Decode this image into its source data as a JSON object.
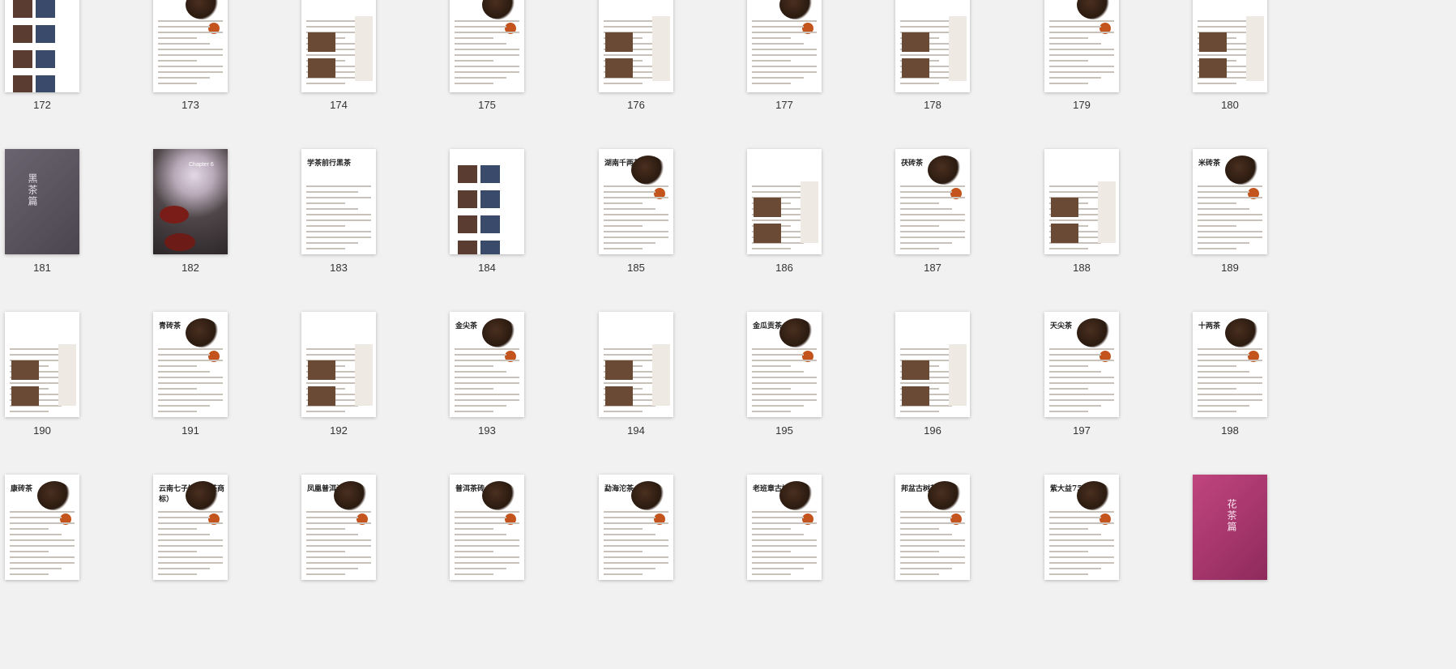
{
  "pages": [
    {
      "label": "172",
      "kind": "photos"
    },
    {
      "label": "173",
      "kind": "tea"
    },
    {
      "label": "174",
      "kind": "text-photos"
    },
    {
      "label": "175",
      "kind": "tea"
    },
    {
      "label": "176",
      "kind": "text-photos"
    },
    {
      "label": "177",
      "kind": "tea"
    },
    {
      "label": "178",
      "kind": "text-photos"
    },
    {
      "label": "179",
      "kind": "tea"
    },
    {
      "label": "180",
      "kind": "text-photos"
    },
    {
      "label": "181",
      "kind": "cover-dark",
      "cover_text": "黑茶篇"
    },
    {
      "label": "182",
      "kind": "cover-photo",
      "cover_text": "Chapter 6"
    },
    {
      "label": "183",
      "kind": "text",
      "title_text": "学茶前行黑茶"
    },
    {
      "label": "184",
      "kind": "photos"
    },
    {
      "label": "185",
      "kind": "tea",
      "title_text": "湖南千两茶"
    },
    {
      "label": "186",
      "kind": "text-photos"
    },
    {
      "label": "187",
      "kind": "tea",
      "title_text": "茯砖茶"
    },
    {
      "label": "188",
      "kind": "text-photos"
    },
    {
      "label": "189",
      "kind": "tea",
      "title_text": "米砖茶"
    },
    {
      "label": "190",
      "kind": "text-photos"
    },
    {
      "label": "191",
      "kind": "tea",
      "title_text": "青砖茶"
    },
    {
      "label": "192",
      "kind": "text-photos"
    },
    {
      "label": "193",
      "kind": "tea",
      "title_text": "金尖茶"
    },
    {
      "label": "194",
      "kind": "text-photos"
    },
    {
      "label": "195",
      "kind": "tea",
      "title_text": "金瓜贡茶"
    },
    {
      "label": "196",
      "kind": "text-photos"
    },
    {
      "label": "197",
      "kind": "tea",
      "title_text": "天尖茶"
    },
    {
      "label": "198",
      "kind": "tea",
      "title_text": "十两茶"
    },
    {
      "label": "",
      "kind": "tea",
      "title_text": "康砖茶"
    },
    {
      "label": "",
      "kind": "tea",
      "title_text": "云南七子饼（中茶商标）"
    },
    {
      "label": "",
      "kind": "tea",
      "title_text": "凤凰普洱沱茶"
    },
    {
      "label": "",
      "kind": "tea",
      "title_text": "普洱茶砖"
    },
    {
      "label": "",
      "kind": "tea",
      "title_text": "勐海沱茶"
    },
    {
      "label": "",
      "kind": "tea",
      "title_text": "老班章古树茶"
    },
    {
      "label": "",
      "kind": "tea",
      "title_text": "邦盆古树茶"
    },
    {
      "label": "",
      "kind": "tea",
      "title_text": "紫大益7542"
    },
    {
      "label": "",
      "kind": "cover-pink",
      "cover_text": "花茶篇"
    }
  ]
}
